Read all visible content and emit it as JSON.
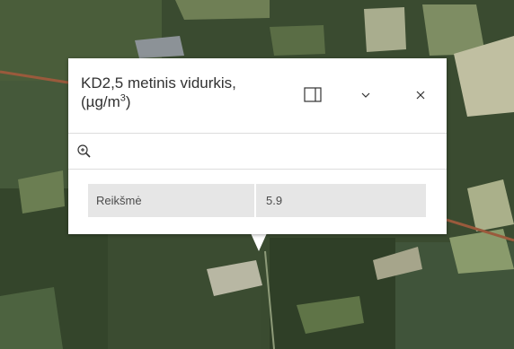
{
  "popup": {
    "title_main": "KD2,5 metinis vidurkis,",
    "title_unit_base": "(µg/m",
    "title_unit_exp": "3",
    "title_unit_close": ")",
    "dock_icon": "dock-side-icon",
    "collapse_icon": "chevron-down-icon",
    "close_icon": "close-icon",
    "zoom_icon": "zoom-to-icon",
    "fields": [
      {
        "name": "Reikšmė",
        "value": "5.9"
      }
    ]
  },
  "colors": {
    "map_dark": "#34452b",
    "map_forest": "#3f5335",
    "field_light": "#a6b088",
    "field_pale": "#c3c2a4",
    "road": "#9a5a3c"
  }
}
